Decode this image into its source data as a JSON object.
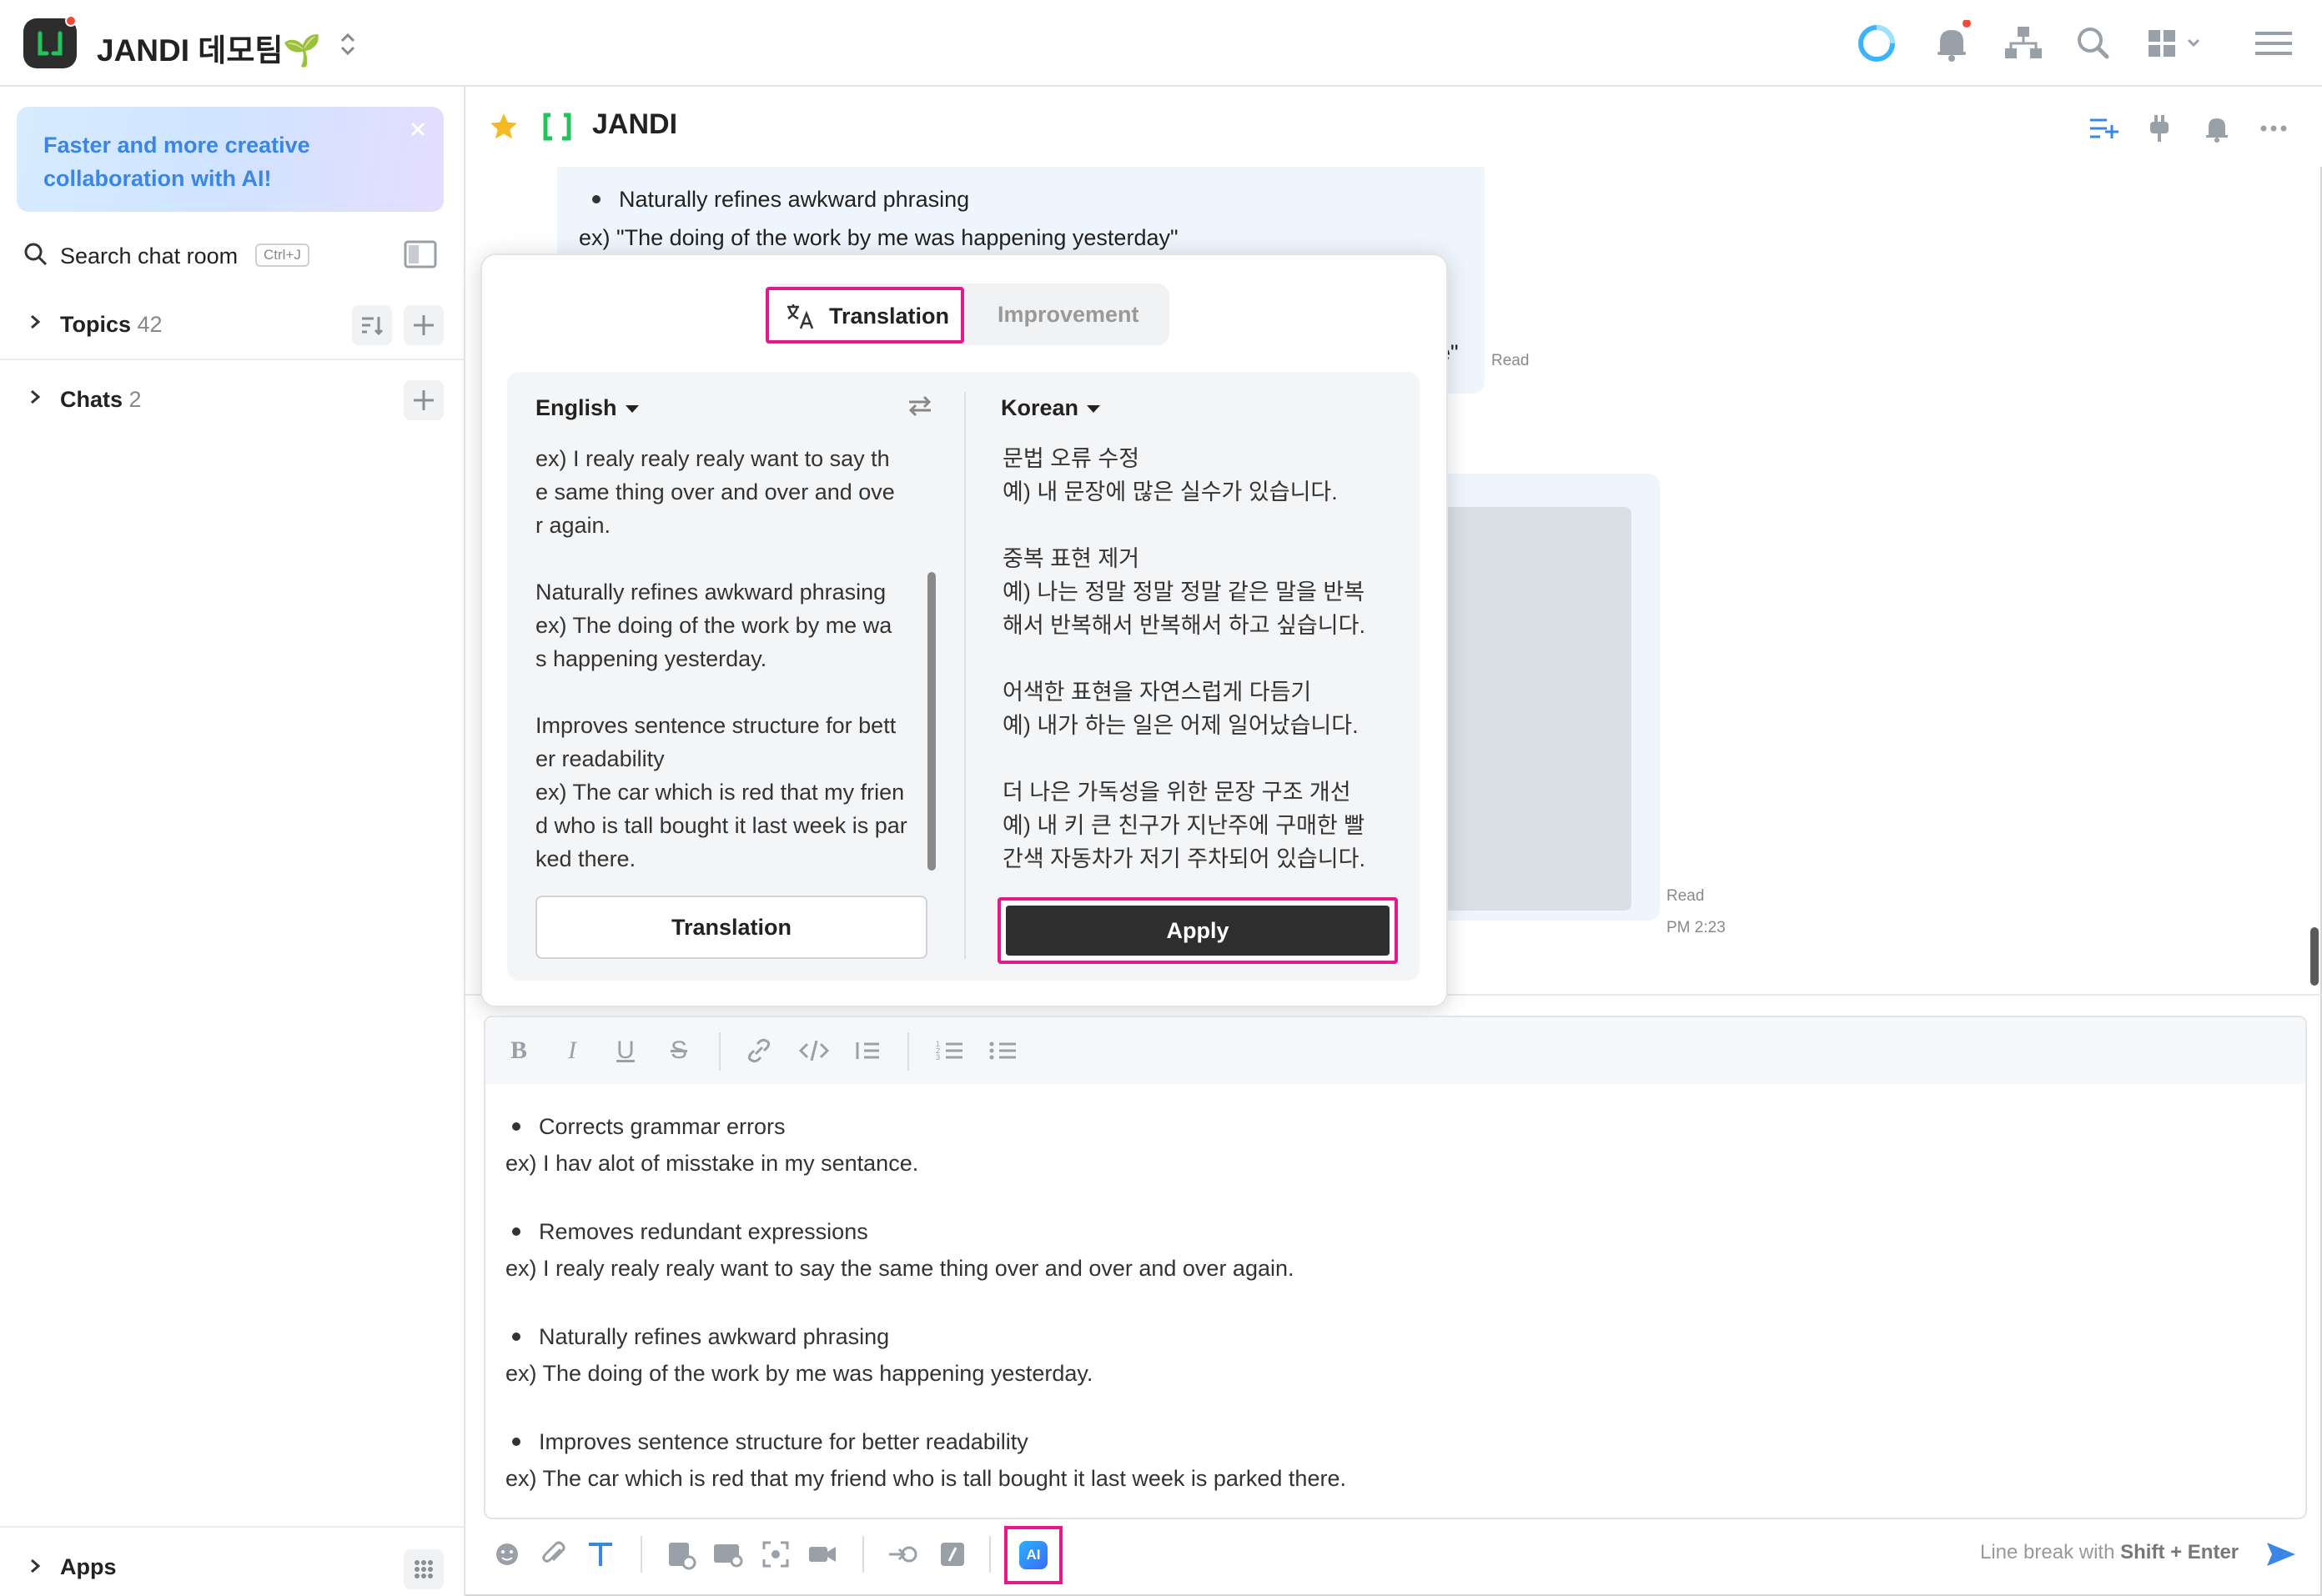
{
  "app": {
    "team_name": "JANDI 데모팀",
    "team_emoji": "🌱"
  },
  "sidebar": {
    "banner_text": "Faster and more creative collaboration with AI!",
    "search_label": "Search chat room",
    "search_shortcut": "Ctrl+J",
    "topics_label": "Topics",
    "topics_count": "42",
    "chats_label": "Chats",
    "chats_count": "2",
    "apps_label": "Apps"
  },
  "channel": {
    "title": "JANDI"
  },
  "chat": {
    "bubble_line1": "Naturally refines awkward phrasing",
    "bubble_line2": "ex) \"The doing of the work by me was happening yesterday\"",
    "bubble_tail": "e\"",
    "read_label_1": "Read",
    "read_label_2": "Read",
    "time_label": "PM 2:23"
  },
  "popup": {
    "tab_translation": "Translation",
    "tab_improvement": "Improvement",
    "source_lang": "English",
    "target_lang": "Korean",
    "source_text": "ex) I realy realy realy want to say th\ne same thing over and over and ove\nr again.\n\nNaturally refines awkward phrasing\nex) The doing of the work by me wa\ns happening yesterday.\n\nImproves sentence structure for bett\ner readability\nex) The car which is red that my frien\nd who is tall bought it last week is par\nked there.",
    "target_text": "문법 오류 수정\n예) 내 문장에 많은 실수가 있습니다.\n\n중복 표현 제거\n예) 나는 정말 정말 정말 같은 말을 반복\n해서 반복해서 반복해서 하고 싶습니다.\n\n어색한 표현을 자연스럽게 다듬기\n예) 내가 하는 일은 어제 일어났습니다.\n\n더 나은 가독성을 위한 문장 구조 개선\n예) 내 키 큰 친구가 지난주에 구매한 빨\n간색 자동차가 저기 주차되어 있습니다.",
    "translate_button": "Translation",
    "apply_button": "Apply"
  },
  "composer": {
    "lines": [
      {
        "bullet": true,
        "text": "Corrects grammar errors"
      },
      {
        "bullet": false,
        "text": "ex) I hav alot of misstake in my sentance."
      },
      {
        "bullet": true,
        "text": "Removes redundant expressions"
      },
      {
        "bullet": false,
        "text": "ex) I realy realy realy want to say the same thing over and over and over again."
      },
      {
        "bullet": true,
        "text": "Naturally refines awkward phrasing"
      },
      {
        "bullet": false,
        "text": "ex) The doing of the work by me was happening yesterday."
      },
      {
        "bullet": true,
        "text": "Improves sentence structure for better readability"
      },
      {
        "bullet": false,
        "text": "ex) The car which is red that my friend who is tall bought it last week is parked there."
      }
    ],
    "hint_prefix": "Line break with",
    "hint_keys": "Shift + Enter",
    "ai_button_label": "AI"
  },
  "colors": {
    "highlight": "#e6178c",
    "brand_green": "#21c35b",
    "link_blue": "#3a86e8"
  }
}
